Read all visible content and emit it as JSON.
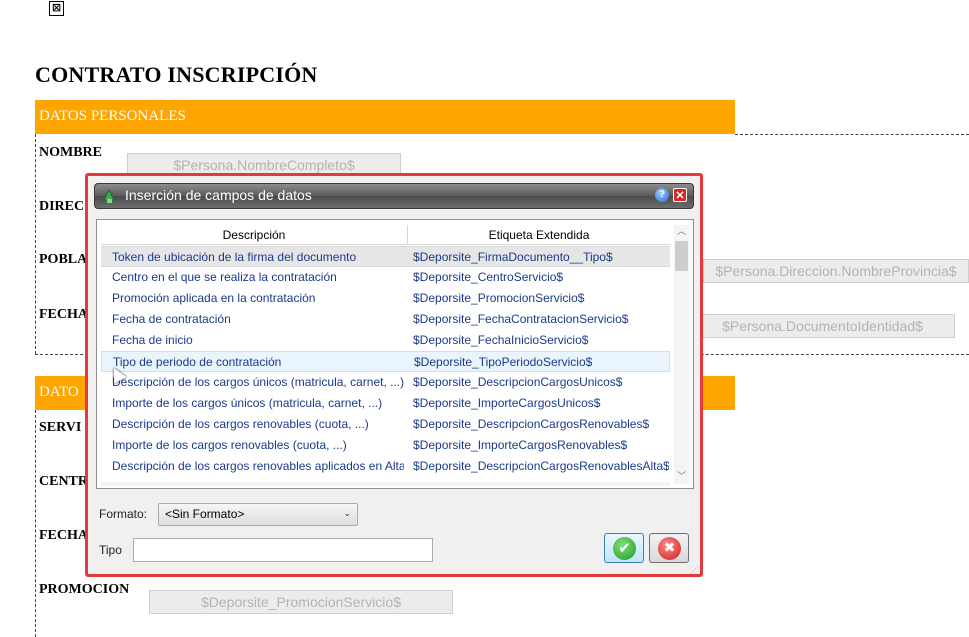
{
  "document": {
    "broken_image_glyph": "⊠",
    "title": "CONTRATO INSCRIPCIÓN",
    "section_1_header": "DATOS PERSONALES",
    "section_2_header": "DATO",
    "labels": {
      "nombre": "NOMBRE",
      "direc": "DIREC",
      "pobla": "POBLA",
      "fecha_1": "FECHA",
      "servi": "SERVI",
      "centr": "CENTR",
      "fecha_2": "FECHA",
      "promocion": "PROMOCION"
    },
    "fields": {
      "nombre_completo": "$Persona.NombreCompleto$",
      "nombre_provincia": "$Persona.Direccion.NombreProvincia$",
      "documento_identidad": "$Persona.DocumentoIdentidad$",
      "promocion_servicio": "$Deporsite_PromocionServicio$"
    }
  },
  "dialog": {
    "title": "Inserción de campos de datos",
    "help_label": "?",
    "close_label": "✕",
    "columns": [
      "Descripción",
      "Etiqueta Extendida"
    ],
    "rows": [
      {
        "descripcion": "Token de ubicación de la firma del documento",
        "etiqueta": "$Deporsite_FirmaDocumento__Tipo$"
      },
      {
        "descripcion": "Centro en el que se realiza la contratación",
        "etiqueta": "$Deporsite_CentroServicio$"
      },
      {
        "descripcion": "Promoción aplicada en la contratación",
        "etiqueta": "$Deporsite_PromocionServicio$"
      },
      {
        "descripcion": "Fecha de contratación",
        "etiqueta": "$Deporsite_FechaContratacionServicio$"
      },
      {
        "descripcion": "Fecha de inicio",
        "etiqueta": "$Deporsite_FechaInicioServicio$"
      },
      {
        "descripcion": "Tipo de periodo de contratación",
        "etiqueta": "$Deporsite_TipoPeriodoServicio$"
      },
      {
        "descripcion": "Descripción de los cargos únicos (matricula, carnet, ...)",
        "etiqueta": "$Deporsite_DescripcionCargosUnicos$"
      },
      {
        "descripcion": "Importe de los cargos únicos (matricula, carnet, ...)",
        "etiqueta": "$Deporsite_ImporteCargosUnicos$"
      },
      {
        "descripcion": "Descripción de los cargos renovables (cuota, ...)",
        "etiqueta": "$Deporsite_DescripcionCargosRenovables$"
      },
      {
        "descripcion": "Importe de los cargos renovables (cuota, ...)",
        "etiqueta": "$Deporsite_ImporteCargosRenovables$"
      },
      {
        "descripcion": "Descripción de los cargos renovables aplicados en Alta",
        "etiqueta": "$Deporsite_DescripcionCargosRenovablesAlta$"
      }
    ],
    "selected_row": 0,
    "hovered_row": 5,
    "formato_label": "Formato:",
    "formato_value": "<Sin Formato>",
    "tipo_label": "Tipo",
    "tipo_value": "",
    "ok_glyph": "✔",
    "cancel_glyph": "✖",
    "scroll_up_glyph": "︿",
    "scroll_down_glyph": "﹀",
    "chevron_glyph": "⌄",
    "colors": {
      "band": "#ffa500",
      "dialog_border": "#e63a3a",
      "row_text": "#1a3a8a"
    }
  }
}
